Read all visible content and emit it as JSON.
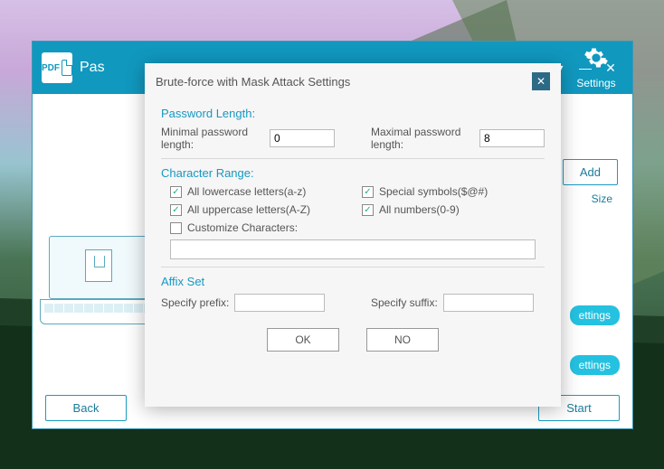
{
  "window": {
    "dropdown_icon": "▾",
    "minimize": "—",
    "close": "✕"
  },
  "app": {
    "logo_text": "PDF",
    "title_fragment": "Pas",
    "settings_label": "Settings",
    "add_button": "Add",
    "size_label": "Size",
    "back_button": "Back",
    "start_button": "Start",
    "pill_text": "ettings"
  },
  "modal": {
    "title": "Brute-force with Mask Attack Settings",
    "close": "✕",
    "password_length": {
      "heading": "Password Length:",
      "min_label": "Minimal password length:",
      "min_value": "0",
      "max_label": "Maximal password length:",
      "max_value": "8"
    },
    "character_range": {
      "heading": "Character Range:",
      "lowercase_label": "All lowercase letters(a-z)",
      "uppercase_label": "All uppercase letters(A-Z)",
      "symbols_label": "Special symbols($@#)",
      "numbers_label": "All numbers(0-9)",
      "customize_label": "Customize Characters:",
      "lowercase_checked": true,
      "uppercase_checked": true,
      "symbols_checked": true,
      "numbers_checked": true,
      "customize_checked": false,
      "customize_value": ""
    },
    "affix": {
      "heading": "Affix Set",
      "prefix_label": "Specify prefix:",
      "prefix_value": "",
      "suffix_label": "Specify suffix:",
      "suffix_value": ""
    },
    "ok": "OK",
    "no": "NO"
  }
}
